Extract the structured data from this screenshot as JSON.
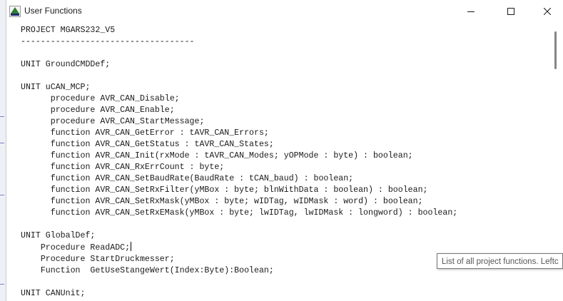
{
  "window": {
    "title": "User Functions",
    "app_icon": "avr-app-icon",
    "controls": [
      "minimize-icon",
      "maximize-icon",
      "close-icon"
    ]
  },
  "editor": {
    "lines": [
      "PROJECT MGARS232_V5",
      "-----------------------------------",
      "",
      "UNIT GroundCMDDef;",
      "",
      "UNIT uCAN_MCP;",
      "      procedure AVR_CAN_Disable;",
      "      procedure AVR_CAN_Enable;",
      "      procedure AVR_CAN_StartMessage;",
      "      function AVR_CAN_GetError : tAVR_CAN_Errors;",
      "      function AVR_CAN_GetStatus : tAVR_CAN_States;",
      "      function AVR_CAN_Init(rxMode : tAVR_CAN_Modes; yOPMode : byte) : boolean;",
      "      function AVR_CAN_RxErrCount : byte;",
      "      function AVR_CAN_SetBaudRate(BaudRate : tCAN_baud) : boolean;",
      "      function AVR_CAN_SetRxFilter(yMBox : byte; blnWithData : boolean) : boolean;",
      "      function AVR_CAN_SetRxMask(yMBox : byte; wIDTag, wIDMask : word) : boolean;",
      "      function AVR_CAN_SetRxEMask(yMBox : byte; lwIDTag, lwIDMask : longword) : boolean;",
      "",
      "UNIT GlobalDef;",
      "    Procedure ReadADC;",
      "    Procedure StartDruckmesser;",
      "    Function  GetUseStangeWert(Index:Byte):Boolean;",
      "",
      "UNIT CANUnit;"
    ],
    "caret_line": 19
  },
  "tooltip": {
    "text": "List of all project functions. Leftc"
  }
}
